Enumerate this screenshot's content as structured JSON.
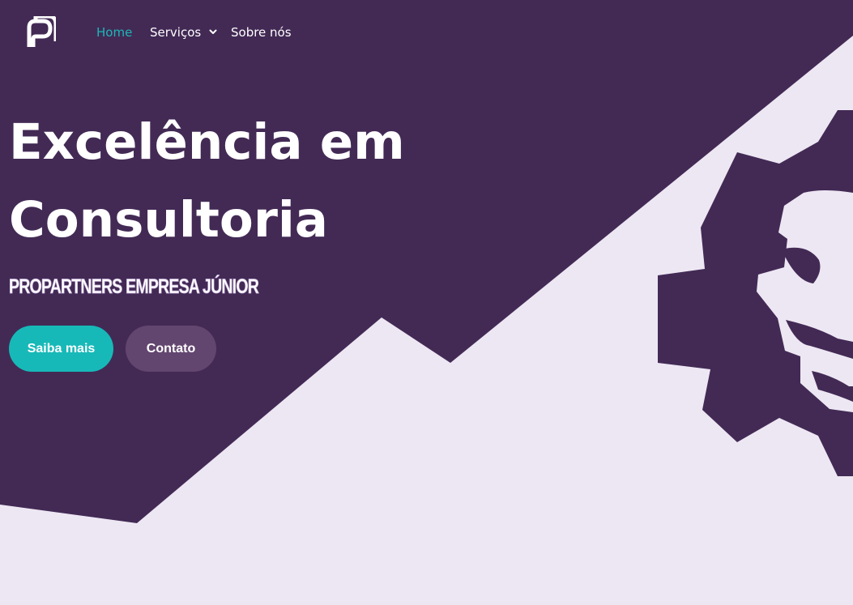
{
  "nav": {
    "logo_icon": "propartners-logo-icon",
    "items": [
      {
        "label": "Home",
        "active": true
      },
      {
        "label": "Serviços",
        "icon": "chevron-down-icon"
      },
      {
        "label": "Sobre nós"
      }
    ]
  },
  "hero": {
    "title_line_1": "Excelência em",
    "title_line_2": "Consultoria",
    "subtitle": "PROPARTNERS EMPRESA JÚNIOR",
    "primary_button": "Saiba mais",
    "secondary_button": "Contato"
  },
  "illustration": {
    "icon": "gear-lion-emblem-icon"
  },
  "theme": {
    "primary": "#432a55",
    "accent": "#1ab8b8",
    "background": "#ede7f3",
    "button_secondary": "#63466f"
  }
}
